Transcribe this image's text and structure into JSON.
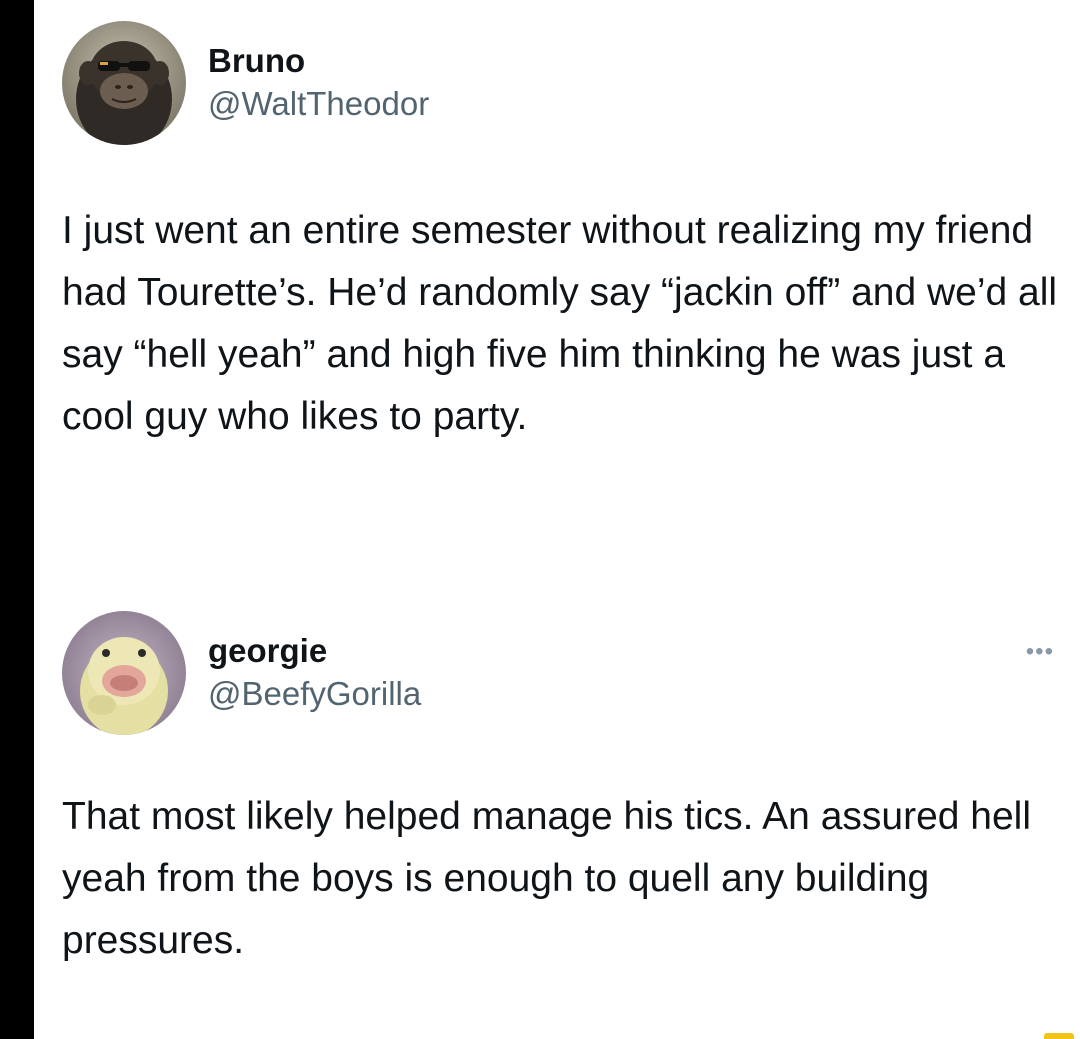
{
  "tweets": [
    {
      "display_name": "Bruno",
      "handle": "@WaltTheodor",
      "avatar_icon": "chimp-with-sunglasses-avatar",
      "text": "I just went an entire semester without realizing my friend had Tourette’s. He’d randomly say “jackin off” and we’d all say “hell yeah” and high five him thinking he was just a cool guy who likes to party."
    },
    {
      "display_name": "georgie",
      "handle": "@BeefyGorilla",
      "avatar_icon": "duckling-avatar",
      "more_icon": "more-options-icon",
      "more_glyph": "•••",
      "text": "That most likely helped manage his tics. An assured hell yeah from the boys is enough to quell any building pressures."
    }
  ],
  "colors": {
    "text_primary": "#0f1419",
    "text_secondary": "#536471",
    "left_bar": "#000000",
    "corner_mark": "#f0c419"
  }
}
